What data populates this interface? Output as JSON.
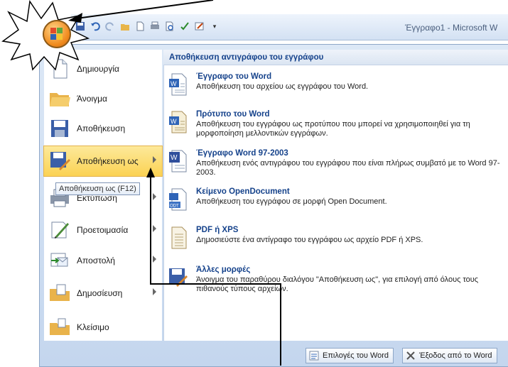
{
  "app": {
    "title": "Έγγραφο1 - Microsoft W"
  },
  "quick_access": [
    "save-icon",
    "undo-icon",
    "redo-icon",
    "open-icon",
    "new-icon",
    "print-icon",
    "print-preview-icon",
    "spelling-icon",
    "edit-icon",
    "customize-icon"
  ],
  "left_menu": {
    "items": [
      {
        "label": "Δημιουργία",
        "icon": "new-doc-icon",
        "submenu": false
      },
      {
        "label": "Άνοιγμα",
        "icon": "open-folder-icon",
        "submenu": false
      },
      {
        "label": "Αποθήκευση",
        "icon": "save-icon",
        "submenu": false
      },
      {
        "label": "Αποθήκευση ως",
        "icon": "save-as-icon",
        "submenu": true,
        "highlighted": true
      },
      {
        "label": "Εκτύπωση",
        "icon": "print-icon",
        "submenu": true
      },
      {
        "label": "Προετοιμασία",
        "icon": "prepare-icon",
        "submenu": true
      },
      {
        "label": "Αποστολή",
        "icon": "send-icon",
        "submenu": true
      },
      {
        "label": "Δημοσίευση",
        "icon": "publish-icon",
        "submenu": true
      },
      {
        "label": "Κλείσιμο",
        "icon": "close-folder-icon",
        "submenu": false
      }
    ],
    "tooltip": "Αποθήκευση ως (F12)"
  },
  "right_panel": {
    "header": "Αποθήκευση αντιγράφου του εγγράφου",
    "options": [
      {
        "title": "Έγγραφο του Word",
        "desc": "Αποθήκευση του αρχείου ως εγγράφου του Word.",
        "icon": "word-document-icon"
      },
      {
        "title": "Πρότυπο του Word",
        "desc": "Αποθήκευση του εγγράφου ως προτύπου που μπορεί να χρησιμοποιηθεί για τη μορφοποίηση μελλοντικών εγγράφων.",
        "icon": "word-template-icon"
      },
      {
        "title": "Έγγραφο Word 97-2003",
        "desc": "Αποθήκευση ενός αντιγράφου του εγγράφου που είναι πλήρως συμβατό με το Word 97-2003.",
        "icon": "word-97-icon"
      },
      {
        "title": "Κείμενο OpenDocument",
        "desc": "Αποθήκευση του εγγράφου σε μορφή Open Document.",
        "icon": "odt-icon"
      },
      {
        "title": "PDF ή XPS",
        "desc": "Δημοσιεύστε ένα αντίγραφο του εγγράφου ως αρχείο PDF ή XPS.",
        "icon": "pdf-xps-icon"
      },
      {
        "title": "Άλλες μορφές",
        "desc": "Άνοιγμα του παραθύρου διαλόγου \"Αποθήκευση ως\", για επιλογή από όλους τους πιθανούς τύπους αρχείων.",
        "icon": "other-formats-icon"
      }
    ]
  },
  "footer": {
    "word_options": "Επιλογές του Word",
    "exit": "Έξοδος από το Word"
  },
  "colors": {
    "accent": "#15428b",
    "highlight": "#fbd253",
    "annotation": "#000000"
  }
}
